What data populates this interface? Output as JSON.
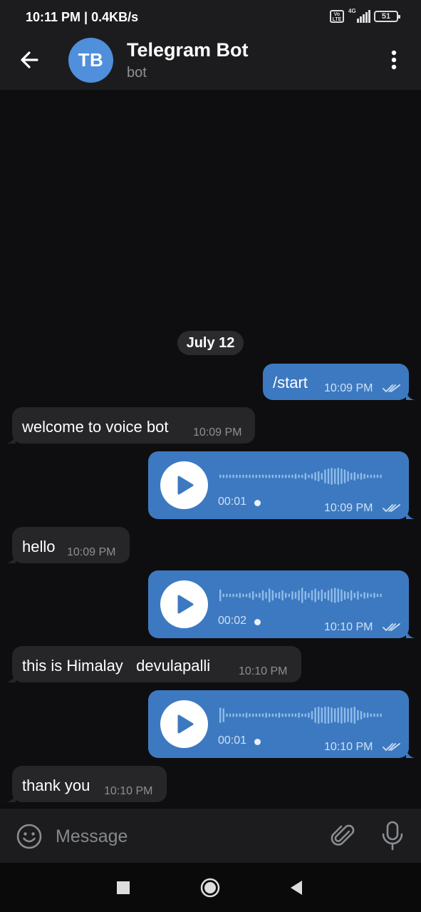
{
  "status_bar": {
    "time_speed": "10:11 PM | 0.4KB/s",
    "volte_label": "Vo LTE",
    "network": "4G",
    "battery": "51"
  },
  "header": {
    "avatar_initials": "TB",
    "title": "Telegram Bot",
    "subtitle": "bot",
    "avatar_color": "#4f8fdc"
  },
  "date_separator": "July 12",
  "messages": [
    {
      "direction": "outgoing",
      "type": "text",
      "text": "/start",
      "time": "10:09 PM",
      "read": true
    },
    {
      "direction": "incoming",
      "type": "text",
      "text": "welcome to voice bot",
      "time": "10:09 PM"
    },
    {
      "direction": "outgoing",
      "type": "voice",
      "duration": "00:01",
      "time": "10:09 PM",
      "read": true
    },
    {
      "direction": "incoming",
      "type": "text",
      "text": "hello",
      "time": "10:09 PM"
    },
    {
      "direction": "outgoing",
      "type": "voice",
      "duration": "00:02",
      "time": "10:10 PM",
      "read": true
    },
    {
      "direction": "incoming",
      "type": "text",
      "text": "this is Himalay   devulapalli",
      "time": "10:10 PM"
    },
    {
      "direction": "outgoing",
      "type": "voice",
      "duration": "00:01",
      "time": "10:10 PM",
      "read": true
    },
    {
      "direction": "incoming",
      "type": "text",
      "text": "thank you",
      "time": "10:10 PM"
    }
  ],
  "input": {
    "placeholder": "Message"
  },
  "icons": {
    "back": "arrow-left-icon",
    "menu": "more-vertical-icon",
    "emoji": "smiley-icon",
    "attach": "paperclip-icon",
    "mic": "microphone-icon",
    "play": "play-icon",
    "read_receipt": "double-check-icon",
    "nav_recents": "square-icon",
    "nav_home": "circle-icon",
    "nav_back": "triangle-back-icon"
  },
  "colors": {
    "outgoing_bubble": "#3d79c0",
    "incoming_bubble": "#262628",
    "background": "#0e0e10",
    "header": "#1c1c1e"
  }
}
